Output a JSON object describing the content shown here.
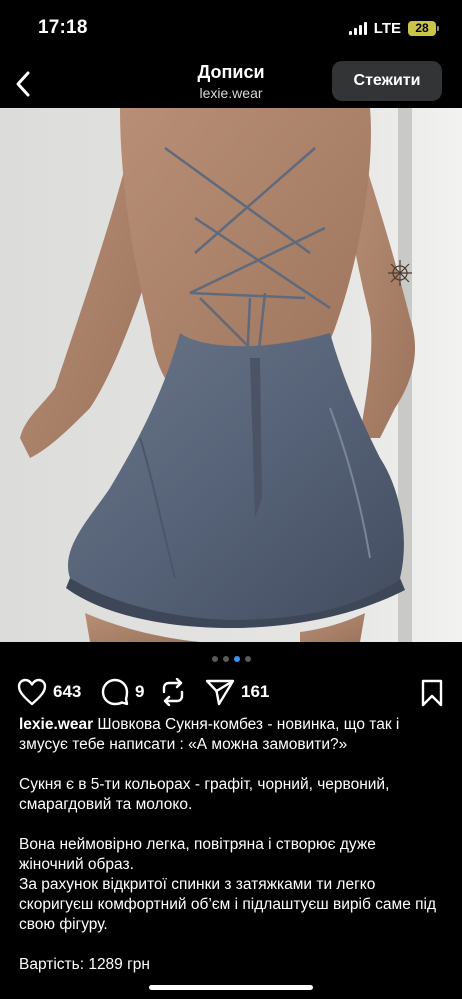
{
  "status": {
    "time": "17:18",
    "network": "LTE",
    "battery": "28"
  },
  "header": {
    "title": "Дописи",
    "subtitle": "lexie.wear",
    "follow_label": "Стежити"
  },
  "carousel": {
    "count": 4,
    "active_index": 2
  },
  "actions": {
    "likes": "643",
    "comments": "9",
    "shares": "161"
  },
  "caption": {
    "username": "lexie.wear",
    "line1": "Шовкова Сукня-комбез - новинка, що так і змусує тебе написати : «А можна замовити?»",
    "para2": "Сукня є в 5-ти кольорах - графіт, чорний, червоний, смарагдовий та молоко.",
    "para3": "Вона неймовірно легка, повітряна і створює дуже жіночний образ.",
    "para4": "За рахунок відкритої спинки з затяжками ти легко скоригуєш комфортний об’єм і підлаштуєш виріб саме під свою фігуру.",
    "para5": "Вартість: 1289 грн"
  },
  "colors": {
    "accent": "#3897f0",
    "battery": "#c9c44a",
    "follow_bg": "#333436",
    "dress": "#59657a"
  },
  "icons": [
    "back-chevron-icon",
    "heart-icon",
    "comment-icon",
    "repost-icon",
    "share-icon",
    "bookmark-icon"
  ]
}
